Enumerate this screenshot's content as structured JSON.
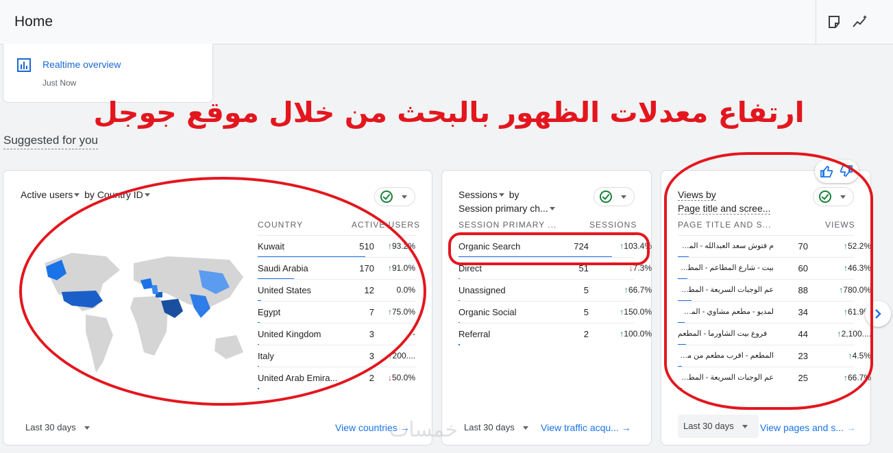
{
  "header": {
    "title": "Home"
  },
  "realtime": {
    "label": "Realtime overview",
    "sub": "Just Now"
  },
  "annotation": {
    "headline": "ارتفاع معدلات الظهور بالبحث من خلال موقع جوجل"
  },
  "section": {
    "title": "Suggested for you"
  },
  "card1": {
    "metric": "Active users",
    "by": "by Country ID",
    "col1": "COUNTRY",
    "col2": "ACTIVE USERS",
    "rows": [
      {
        "name": "Kuwait",
        "value": "510",
        "change": "93.2%",
        "dir": "up",
        "bar": 0.98
      },
      {
        "name": "Saudi Arabia",
        "value": "170",
        "change": "91.0%",
        "dir": "up",
        "bar": 0.33
      },
      {
        "name": "United States",
        "value": "12",
        "change": "0.0%",
        "dir": "none",
        "bar": 0.03
      },
      {
        "name": "Egypt",
        "value": "7",
        "change": "75.0%",
        "dir": "up",
        "bar": 0.02
      },
      {
        "name": "United Kingdom",
        "value": "3",
        "change": "-",
        "dir": "none",
        "bar": 0.01
      },
      {
        "name": "Italy",
        "value": "3",
        "change": "200....",
        "dir": "up",
        "bar": 0.01
      },
      {
        "name": "United Arab Emira...",
        "value": "2",
        "change": "50.0%",
        "dir": "down",
        "bar": 0.01
      }
    ],
    "date": "Last 30 days",
    "link": "View countries"
  },
  "card2": {
    "metric": "Sessions",
    "by": "by",
    "dim": "Session primary ch...",
    "col1": "SESSION PRIMARY ...",
    "col2": "SESSIONS",
    "rows": [
      {
        "name": "Organic Search",
        "value": "724",
        "change": "103.4%",
        "dir": "up",
        "bar": 0.95
      },
      {
        "name": "Direct",
        "value": "51",
        "change": "7.3%",
        "dir": "down",
        "bar": 0.01
      },
      {
        "name": "Unassigned",
        "value": "5",
        "change": "66.7%",
        "dir": "up",
        "bar": 0.01
      },
      {
        "name": "Organic Social",
        "value": "5",
        "change": "150.0%",
        "dir": "up",
        "bar": 0.01
      },
      {
        "name": "Referral",
        "value": "2",
        "change": "100.0%",
        "dir": "up",
        "bar": 0.01
      }
    ],
    "date": "Last 30 days",
    "link": "View traffic acqu..."
  },
  "card3": {
    "metric": "Views by",
    "dim": "Page title and scree...",
    "col1": "PAGE TITLE AND S...",
    "col2": "VIEWS",
    "rows": [
      {
        "name": "م فتوش سعد العبدالله - المطعم...",
        "value": "70",
        "change": "52.2%",
        "dir": "up",
        "bar": 0.08
      },
      {
        "name": "بيت - شارع المطاعم - المطعم...",
        "value": "60",
        "change": "46.3%",
        "dir": "up",
        "bar": 0.07
      },
      {
        "name": "عم الوجبات السريعة - المطعم...",
        "value": "88",
        "change": "780.0%",
        "dir": "up",
        "bar": 0.1
      },
      {
        "name": "لمديو - مطعم مشاوي - المطعم...",
        "value": "34",
        "change": "61.9%",
        "dir": "up",
        "bar": 0.05
      },
      {
        "name": "فروع بيت الشاورما - المطعم",
        "value": "44",
        "change": "2,100....",
        "dir": "up",
        "bar": 0.06
      },
      {
        "name": "المطعم - اقرب مطعم من موقعي",
        "value": "23",
        "change": "4.5%",
        "dir": "up",
        "bar": 0.03
      },
      {
        "name": "عم الوجبات السريعة - المطعم...",
        "value": "25",
        "change": "66.7%",
        "dir": "up",
        "bar": 0.03
      }
    ],
    "date": "Last 30 days",
    "link": "View pages and s..."
  },
  "watermark": "خمسات",
  "icons": [
    "notes-icon",
    "insights-icon",
    "bar-chart-icon",
    "check-circle-icon",
    "thumbs-up-icon",
    "thumbs-down-icon",
    "chevron-right-icon",
    "arrow-right-icon"
  ]
}
